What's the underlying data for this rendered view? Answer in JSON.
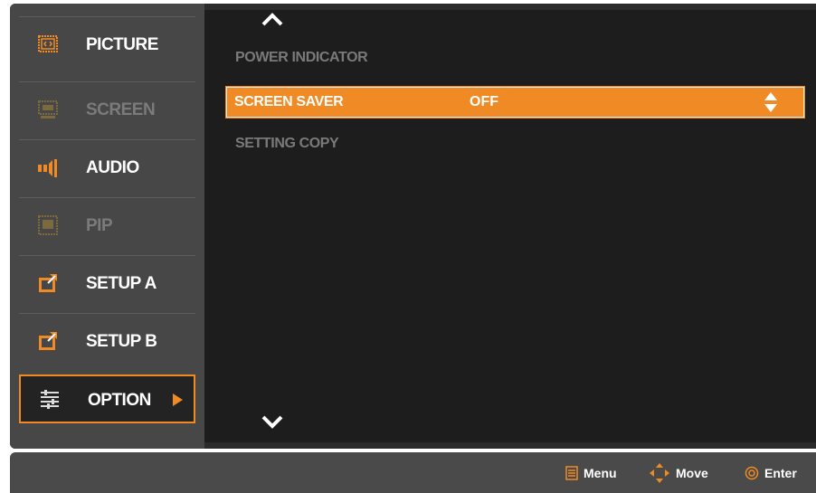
{
  "sidebar": {
    "items": [
      {
        "label": "PICTURE",
        "icon": "picture-icon",
        "enabled": true,
        "selected": false
      },
      {
        "label": "SCREEN",
        "icon": "screen-icon",
        "enabled": false,
        "selected": false
      },
      {
        "label": "AUDIO",
        "icon": "audio-icon",
        "enabled": true,
        "selected": false
      },
      {
        "label": "PIP",
        "icon": "pip-icon",
        "enabled": false,
        "selected": false
      },
      {
        "label": "SETUP A",
        "icon": "setup-icon",
        "enabled": true,
        "selected": false
      },
      {
        "label": "SETUP B",
        "icon": "setup-icon",
        "enabled": true,
        "selected": false
      },
      {
        "label": "OPTION",
        "icon": "option-icon",
        "enabled": true,
        "selected": true
      }
    ]
  },
  "content": {
    "rows": [
      {
        "label": "POWER INDICATOR",
        "value": "",
        "highlighted": false
      },
      {
        "label": "SCREEN SAVER",
        "value": "OFF",
        "highlighted": true
      },
      {
        "label": "SETTING COPY",
        "value": "",
        "highlighted": false
      }
    ]
  },
  "bottom_bar": {
    "menu_label": "Menu",
    "move_label": "Move",
    "enter_label": "Enter"
  },
  "colors": {
    "accent": "#f08a24",
    "sidebar_bg": "#474747",
    "content_bg": "#1d1d1d",
    "disabled_text": "#7a7a7a"
  }
}
